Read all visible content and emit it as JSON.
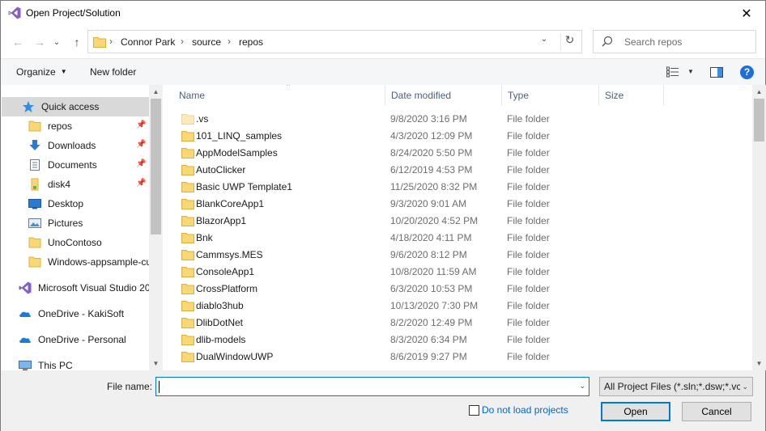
{
  "window": {
    "title": "Open Project/Solution",
    "close_glyph": "✕"
  },
  "navigation": {
    "back_glyph": "←",
    "forward_glyph": "→",
    "dropdown_glyph": "⌄",
    "up_glyph": "↑"
  },
  "address": {
    "breadcrumbs": [
      "Connor Park",
      "source",
      "repos"
    ],
    "separator": "›",
    "dropdown_glyph": "⌄",
    "refresh_glyph": "↻"
  },
  "search": {
    "placeholder": "Search repos"
  },
  "commandbar": {
    "organize_label": "Organize",
    "new_folder_label": "New folder",
    "help_label": "?"
  },
  "sidebar": {
    "items": [
      {
        "label": "Quick access",
        "icon": "star-icon",
        "pinned": false,
        "indent": 1
      },
      {
        "label": "repos",
        "icon": "folder-icon",
        "pinned": true,
        "indent": 2
      },
      {
        "label": "Downloads",
        "icon": "download-icon",
        "pinned": true,
        "indent": 2
      },
      {
        "label": "Documents",
        "icon": "documents-icon",
        "pinned": true,
        "indent": 2
      },
      {
        "label": "disk4",
        "icon": "folder-icon",
        "pinned": true,
        "indent": 2
      },
      {
        "label": "Desktop",
        "icon": "desktop-icon",
        "pinned": false,
        "indent": 2
      },
      {
        "label": "Pictures",
        "icon": "pictures-icon",
        "pinned": false,
        "indent": 2
      },
      {
        "label": "UnoContoso",
        "icon": "folder-icon",
        "pinned": false,
        "indent": 2
      },
      {
        "label": "Windows-appsample-cu",
        "icon": "folder-icon",
        "pinned": false,
        "indent": 2
      },
      {
        "label": "Microsoft Visual Studio 20",
        "icon": "visual-studio-icon",
        "pinned": false,
        "indent": 1
      },
      {
        "label": "OneDrive - KakiSoft",
        "icon": "onedrive-icon",
        "pinned": false,
        "indent": 1
      },
      {
        "label": "OneDrive - Personal",
        "icon": "onedrive-icon",
        "pinned": false,
        "indent": 1
      },
      {
        "label": "This PC",
        "icon": "computer-icon",
        "pinned": false,
        "indent": 1
      }
    ]
  },
  "filelist": {
    "columns": [
      "Name",
      "Date modified",
      "Type",
      "Size"
    ],
    "sort_glyph": "^",
    "rows": [
      {
        "name": ".vs",
        "date": "9/8/2020 3:16 PM",
        "type": "File folder",
        "hidden": true
      },
      {
        "name": "101_LINQ_samples",
        "date": "4/3/2020 12:09 PM",
        "type": "File folder"
      },
      {
        "name": "AppModelSamples",
        "date": "8/24/2020 5:50 PM",
        "type": "File folder"
      },
      {
        "name": "AutoClicker",
        "date": "6/12/2019 4:53 PM",
        "type": "File folder"
      },
      {
        "name": "Basic UWP Template1",
        "date": "11/25/2020 8:32 PM",
        "type": "File folder"
      },
      {
        "name": "BlankCoreApp1",
        "date": "9/3/2020 9:01 AM",
        "type": "File folder"
      },
      {
        "name": "BlazorApp1",
        "date": "10/20/2020 4:52 PM",
        "type": "File folder"
      },
      {
        "name": "Bnk",
        "date": "4/18/2020 4:11 PM",
        "type": "File folder"
      },
      {
        "name": "Cammsys.MES",
        "date": "9/6/2020 8:12 PM",
        "type": "File folder"
      },
      {
        "name": "ConsoleApp1",
        "date": "10/8/2020 11:59 AM",
        "type": "File folder"
      },
      {
        "name": "CrossPlatform",
        "date": "6/3/2020 10:53 PM",
        "type": "File folder"
      },
      {
        "name": "diablo3hub",
        "date": "10/13/2020 7:30 PM",
        "type": "File folder"
      },
      {
        "name": "DlibDotNet",
        "date": "8/2/2020 12:49 PM",
        "type": "File folder"
      },
      {
        "name": "dlib-models",
        "date": "8/3/2020 6:34 PM",
        "type": "File folder"
      },
      {
        "name": "DualWindowUWP",
        "date": "8/6/2019 9:27 PM",
        "type": "File folder"
      }
    ]
  },
  "bottom": {
    "file_name_label": "File name:",
    "file_name_value": "",
    "filter_value": "All Project Files (*.sln;*.dsw;*.vc",
    "dropdown_glyph": "⌄",
    "do_not_load_label": "Do not load projects",
    "open_label": "Open",
    "cancel_label": "Cancel"
  },
  "colors": {
    "accent": "#0078d7",
    "folder": "#f4c95d",
    "link": "#0066cc",
    "selected": "#d9d9d9"
  }
}
